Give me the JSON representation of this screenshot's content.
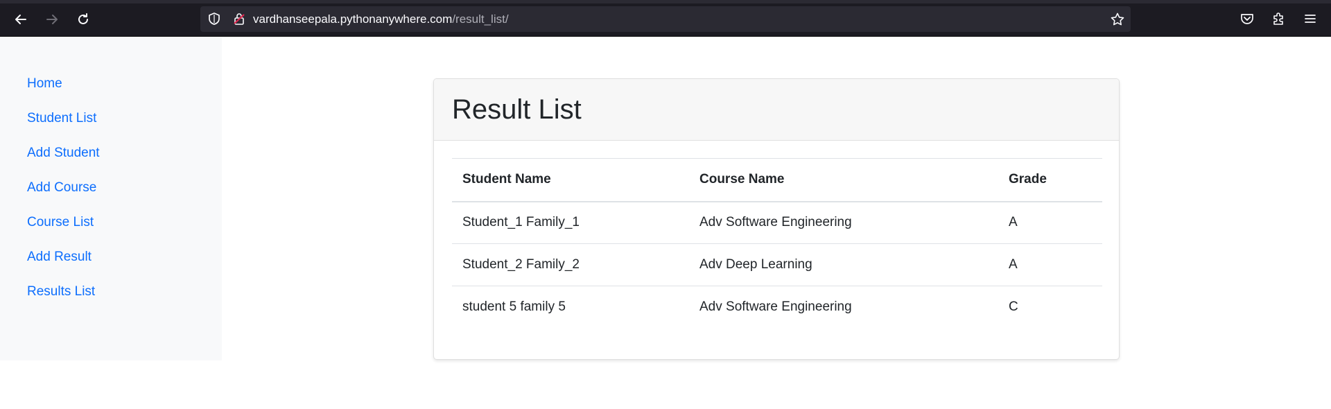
{
  "browser": {
    "url_host": "vardhanseepala.pythonanywhere.com",
    "url_path": "/result_list/"
  },
  "sidebar": {
    "items": [
      {
        "label": "Home"
      },
      {
        "label": "Student List"
      },
      {
        "label": "Add Student"
      },
      {
        "label": "Add Course"
      },
      {
        "label": "Course List"
      },
      {
        "label": "Add Result"
      },
      {
        "label": "Results List"
      }
    ]
  },
  "main": {
    "title": "Result List",
    "table": {
      "headers": [
        "Student Name",
        "Course Name",
        "Grade"
      ],
      "rows": [
        [
          "Student_1 Family_1",
          "Adv Software Engineering",
          "A"
        ],
        [
          "Student_2 Family_2",
          "Adv Deep Learning",
          "A"
        ],
        [
          "student 5 family 5",
          "Adv Software Engineering",
          "C"
        ]
      ]
    }
  },
  "icons": {
    "back": "arrow-left-icon",
    "forward": "arrow-right-icon",
    "reload": "reload-icon",
    "tracking": "shield-icon",
    "lock": "insecure-lock-icon",
    "bookmark": "star-icon",
    "pocket": "pocket-icon",
    "extensions": "puzzle-icon",
    "menu": "hamburger-menu-icon"
  },
  "colors": {
    "link": "#0d6efd",
    "chrome": "#1c1b22",
    "sidebar_bg": "#f8f9fa"
  }
}
